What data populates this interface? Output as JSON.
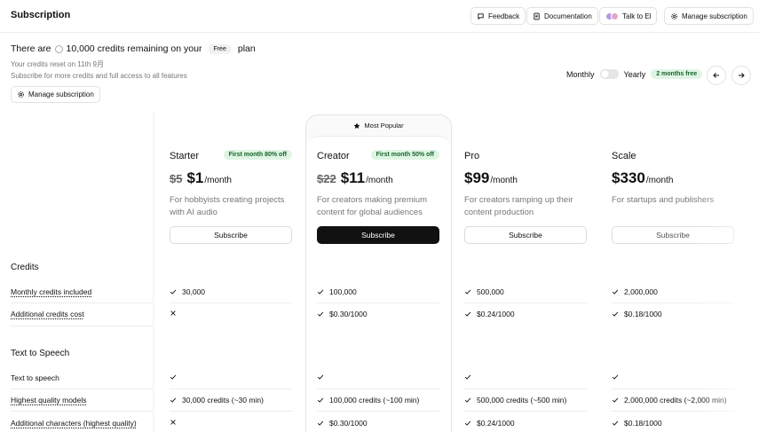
{
  "header": {
    "title": "Subscription",
    "feedback": "Feedback",
    "documentation": "Documentation",
    "talk": "Talk to El",
    "manage": "Manage subscription"
  },
  "credits_info": {
    "prefix": "There are",
    "amount": "10,000 credits remaining on your",
    "plan_pill": "Free",
    "suffix": "plan",
    "reset": "Your credits reset on 11th 9月",
    "subscribe_note": "Subscribe for more credits and full access to all features",
    "manage_button": "Manage subscription"
  },
  "billing": {
    "monthly": "Monthly",
    "yearly": "Yearly",
    "free_months": "2 months free"
  },
  "popular_label": "Most Popular",
  "plans": [
    {
      "name": "Starter",
      "badge": "First month 80% off",
      "old_price": "$5",
      "price": "$1",
      "unit": "/month",
      "desc": "For hobbyists creating projects with AI audio",
      "button": "Subscribe"
    },
    {
      "name": "Creator",
      "badge": "First month 50% off",
      "old_price": "$22",
      "price": "$11",
      "unit": "/month",
      "desc": "For creators making premium content for global audiences",
      "button": "Subscribe"
    },
    {
      "name": "Pro",
      "badge": "",
      "old_price": "",
      "price": "$99",
      "unit": "/month",
      "desc": "For creators ramping up their content production",
      "button": "Subscribe"
    },
    {
      "name": "Scale",
      "badge": "",
      "old_price": "",
      "price": "$330",
      "unit": "/month",
      "desc": "For startups and publishers",
      "button": "Subscribe"
    }
  ],
  "sections": {
    "credits": "Credits",
    "tts": "Text to Speech"
  },
  "rows": {
    "monthly_credits": {
      "label": "Monthly credits included",
      "values": [
        "30,000",
        "100,000",
        "500,000",
        "2,000,000"
      ]
    },
    "additional_cost": {
      "label": "Additional credits cost",
      "values": [
        "",
        "$0.30/1000",
        "$0.24/1000",
        "$0.18/1000"
      ]
    },
    "tts": {
      "label": "Text to speech"
    },
    "hq_models": {
      "label": "Highest quality models",
      "values": [
        "30,000 credits (~30 min)",
        "100,000 credits (~100 min)",
        "500,000 credits (~500 min)",
        "2,000,000 credits (~2,000 min)"
      ]
    },
    "additional_chars": {
      "label": "Additional characters (highest quality)",
      "values": [
        "",
        "$0.30/1000",
        "$0.24/1000",
        "$0.18/1000"
      ]
    }
  }
}
